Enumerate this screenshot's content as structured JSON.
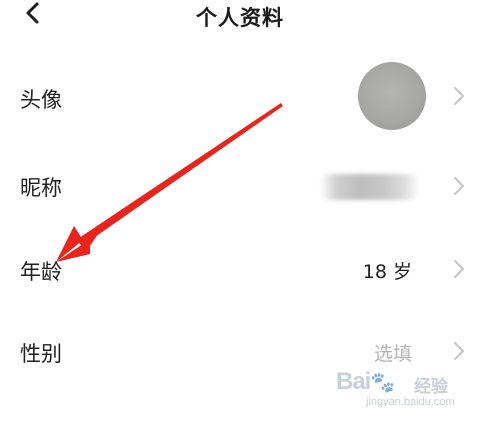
{
  "header": {
    "back_icon": "chevron-left-icon",
    "title": "个人资料"
  },
  "rows": [
    {
      "label": "头像",
      "value": "",
      "icon": "avatar-image"
    },
    {
      "label": "昵称",
      "value": "",
      "note": "nickname obscured"
    },
    {
      "label": "年龄",
      "value": "18 岁"
    },
    {
      "label": "性别",
      "value": "选填"
    }
  ],
  "chevron_icon": "chevron-right-icon",
  "annotation": {
    "color": "#e8241c"
  },
  "watermark": {
    "brand": "Bai 经验",
    "cn": "经验",
    "url": "jingyan.baidu.com"
  },
  "colors": {
    "text": "#1f1f1f",
    "placeholder": "#b5b5b5",
    "chevron": "#c4c4c4",
    "annotation": "#e8241c"
  }
}
